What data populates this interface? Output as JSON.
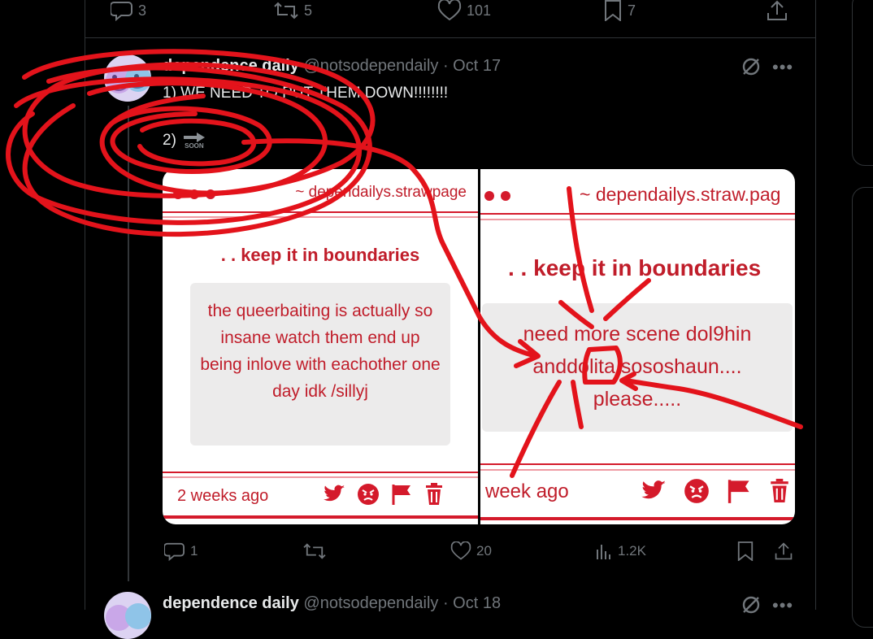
{
  "colors": {
    "accent": "#d41a2b",
    "muted": "#71767b",
    "scribble": "#e3131b"
  },
  "top_actions": {
    "replies": "3",
    "reposts": "5",
    "likes": "101",
    "bookmarks": "7"
  },
  "tweet": {
    "display_name": "dependence daily",
    "meta": "@notsodependaily · Oct 17",
    "line1": "1) WE NEED TO PUT THEM DOWN!!!!!!!!",
    "line2_prefix": "2)",
    "soon_label": "SOON",
    "icons": [
      "grok-icon",
      "more-icon"
    ],
    "actions": {
      "replies": "1",
      "reposts": "",
      "likes": "20",
      "views": "1.2K"
    }
  },
  "card_left": {
    "url": "~ dependailys.strawpage",
    "title": ". . keep it in boundaries",
    "message": "the queerbaiting is actually so insane watch them end up being inlove with eachother one day idk /sillyj",
    "time": "2 weeks ago",
    "icons": [
      "twitter-icon",
      "angry-icon",
      "flag-icon",
      "trash-icon"
    ]
  },
  "card_right": {
    "url": "~ dependailys.straw.pag",
    "title": ". . keep it in boundaries",
    "message": "need more scene dol9hin anddolita sososhaun.... please.....",
    "time": "week ago",
    "icons": [
      "twitter-icon",
      "angry-icon",
      "flag-icon",
      "trash-icon"
    ]
  },
  "next_tweet": {
    "display_name": "dependence daily",
    "meta": "@notsodependaily · Oct 18"
  }
}
